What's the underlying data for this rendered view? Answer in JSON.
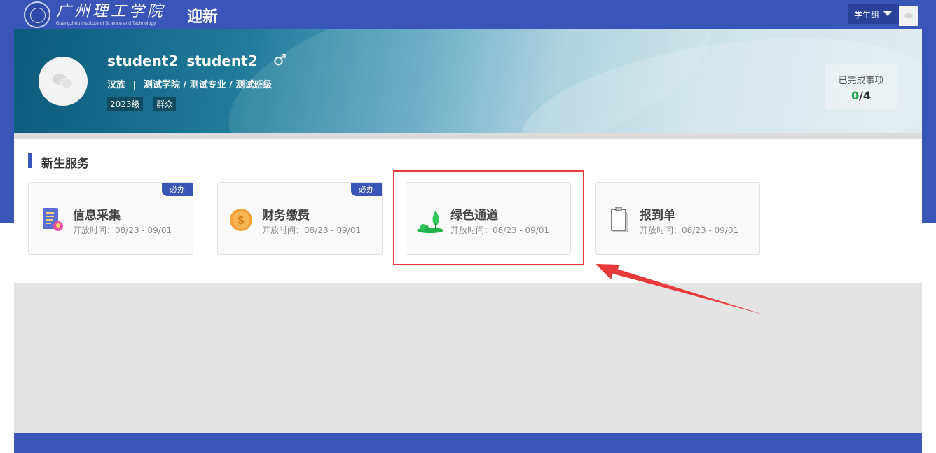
{
  "header": {
    "logo_text_cn": "广州理工学院",
    "logo_text_en": "Guangzhou Institute of Science and Technology",
    "app_title": "迎新",
    "role_label": "学生组"
  },
  "profile": {
    "name_primary": "student2",
    "name_secondary": "student2",
    "gender_symbol": "♂",
    "ethnicity": "汉族",
    "separator": "|",
    "org_path": "测试学院 / 测试专业 / 测试班级",
    "tags": [
      "2023级",
      "群众"
    ]
  },
  "progress": {
    "label": "已完成事项",
    "completed": "0",
    "slash": "/",
    "total": "4"
  },
  "section": {
    "title": "新生服务"
  },
  "cards": [
    {
      "title": "信息采集",
      "time_label": "开放时间：08/23 - 09/01",
      "badge": "必办",
      "icon": "document-form-icon"
    },
    {
      "title": "财务缴费",
      "time_label": "开放时间：08/23 - 09/01",
      "badge": "必办",
      "icon": "coin-icon"
    },
    {
      "title": "绿色通道",
      "time_label": "开放时间：08/23 - 09/01",
      "badge": "",
      "icon": "green-tree-icon"
    },
    {
      "title": "报到单",
      "time_label": "开放时间：08/23 - 09/01",
      "badge": "",
      "icon": "clipboard-icon"
    }
  ],
  "colors": {
    "brand_blue": "#3a55b8",
    "highlight_red": "#e83a3a",
    "done_green": "#1aa34a"
  }
}
